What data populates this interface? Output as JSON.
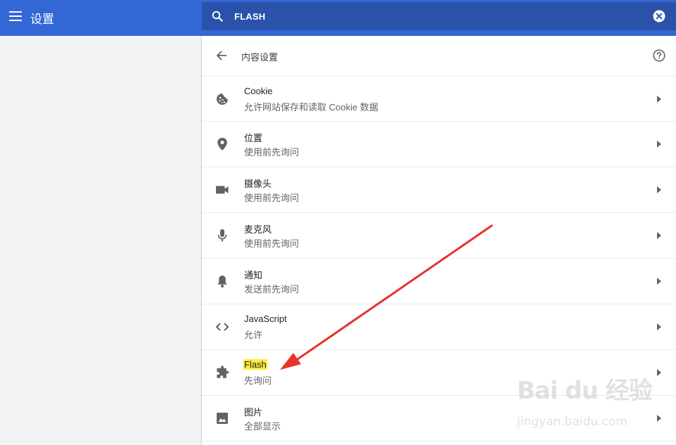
{
  "header": {
    "title": "设置",
    "search_value": "FLASH"
  },
  "page": {
    "title": "内容设置"
  },
  "items": [
    {
      "title": "Cookie",
      "subtitle": "允许网站保存和读取 Cookie 数据",
      "icon": "cookie-icon"
    },
    {
      "title": "位置",
      "subtitle": "使用前先询问",
      "icon": "location-icon"
    },
    {
      "title": "摄像头",
      "subtitle": "使用前先询问",
      "icon": "camera-icon"
    },
    {
      "title": "麦克风",
      "subtitle": "使用前先询问",
      "icon": "microphone-icon"
    },
    {
      "title": "通知",
      "subtitle": "发送前先询问",
      "icon": "bell-icon"
    },
    {
      "title": "JavaScript",
      "subtitle": "允许",
      "icon": "code-icon"
    },
    {
      "title": "Flash",
      "subtitle": "先询问",
      "icon": "puzzle-icon",
      "highlighted": true
    },
    {
      "title": "图片",
      "subtitle": "全部显示",
      "icon": "image-icon"
    }
  ],
  "watermark": {
    "brand": "Bai du 经验",
    "url": "jingyan.baidu.com"
  },
  "colors": {
    "toolbar": "#3367d6",
    "search_bg": "#2a52ab",
    "highlight": "#ffeb3b",
    "arrow": "#e8332a"
  }
}
